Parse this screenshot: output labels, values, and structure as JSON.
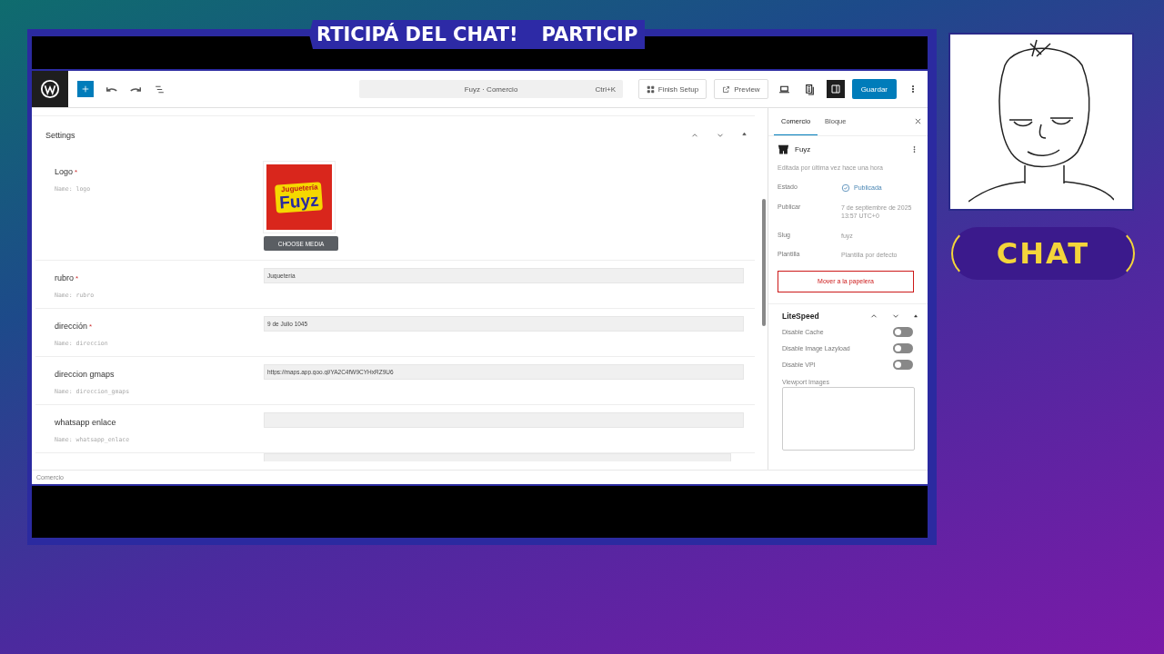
{
  "banner": [
    "RTICIPÁ DEL CHAT!",
    "PARTICIP"
  ],
  "toolbar": {
    "search": "Fuyz · Comercio",
    "shortcut": "Ctrl+K",
    "finish_setup": "Finish Setup",
    "preview": "Preview",
    "save": "Guardar"
  },
  "settings": {
    "title": "Settings",
    "fields": [
      {
        "kind": "media",
        "label": "Logo",
        "mark": "*",
        "name": "Name: logo",
        "logo": [
          "Juguetería",
          "Fuyz"
        ],
        "button": "CHOOSE MEDIA"
      },
      {
        "kind": "text",
        "label": "rubro",
        "mark": "*",
        "name": "Name: rubro",
        "value": "Juguetería"
      },
      {
        "kind": "text",
        "label": "dirección",
        "mark": "*",
        "name": "Name: direccion",
        "value": "9 de Julio 1045"
      },
      {
        "kind": "text",
        "label": "direccion gmaps",
        "name": "Name: direccion_gmaps",
        "value": "https://maps.app.goo.gl/YA2C4fW9CYHxRZ9U6"
      },
      {
        "kind": "text",
        "label": "whatsapp enlace",
        "name": "Name: whatsapp_enlace"
      }
    ]
  },
  "footer": "Comercio",
  "sidebar": {
    "tabs": [
      {
        "label": "Comercio",
        "selected": true
      },
      {
        "label": "Bloque",
        "selected": false
      }
    ],
    "post": {
      "title": "Fuyz",
      "edited": "Editada por última vez hace una hora"
    },
    "meta": [
      {
        "kind": "status",
        "label": "Estado",
        "value": "Publicada"
      },
      {
        "kind": "plain",
        "label": "Publicar",
        "value": "7 de septiembre de 2025 13:57 UTC+0"
      },
      {
        "kind": "plain",
        "label": "Slug",
        "value": "fuyz"
      },
      {
        "kind": "plain",
        "label": "Plantilla",
        "value": "Plantilla por defecto"
      }
    ],
    "trash": "Mover a la papelera",
    "litespeed": {
      "title": "LiteSpeed",
      "toggles": [
        {
          "label": "Disable Cache",
          "on": false
        },
        {
          "label": "Disable Image Lazyload",
          "on": false
        },
        {
          "label": "Disable VPI",
          "on": false
        }
      ],
      "textarea_label": "Viewport Images"
    }
  },
  "chat_badge": "CHAT"
}
